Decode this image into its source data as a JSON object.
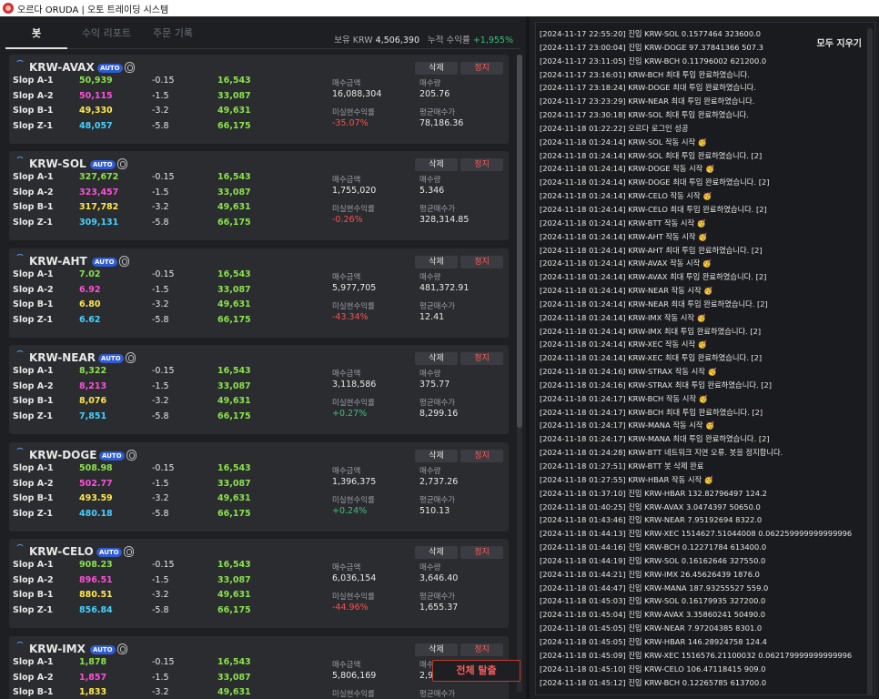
{
  "window": {
    "title": "오르다 ORUDA | 오토 트레이딩 시스템"
  },
  "tabs": [
    {
      "label": "봇"
    },
    {
      "label": "수익 리포트"
    },
    {
      "label": "주문 기록"
    }
  ],
  "summary": {
    "krw_label": "보유 KRW",
    "krw_value": "4,506,390",
    "return_label": "누적 수익률",
    "return_value": "+1,955%"
  },
  "card_labels": {
    "buy_amount": "매수금액",
    "buy_qty": "매수량",
    "unrealized": "미실현수익률",
    "avg_price": "평균매수가",
    "delete": "삭제",
    "stop": "정지",
    "auto": "AUTO"
  },
  "bots": [
    {
      "coin": "KRW-AVAX",
      "rows": [
        {
          "label": "Slop A-1",
          "price": "50,939",
          "pct": "-0.15",
          "target": "16,543"
        },
        {
          "label": "Slop A-2",
          "price": "50,115",
          "pct": "-1.5",
          "target": "33,087"
        },
        {
          "label": "Slop B-1",
          "price": "49,330",
          "pct": "-3.2",
          "target": "49,631"
        },
        {
          "label": "Slop Z-1",
          "price": "48,057",
          "pct": "-5.8",
          "target": "66,175"
        }
      ],
      "buy_amount": "16,088,304",
      "buy_qty": "205.76",
      "unrealized": "-35.07%",
      "avg_price": "78,186.36"
    },
    {
      "coin": "KRW-SOL",
      "rows": [
        {
          "label": "Slop A-1",
          "price": "327,672",
          "pct": "-0.15",
          "target": "16,543"
        },
        {
          "label": "Slop A-2",
          "price": "323,457",
          "pct": "-1.5",
          "target": "33,087"
        },
        {
          "label": "Slop B-1",
          "price": "317,782",
          "pct": "-3.2",
          "target": "49,631"
        },
        {
          "label": "Slop Z-1",
          "price": "309,131",
          "pct": "-5.8",
          "target": "66,175"
        }
      ],
      "buy_amount": "1,755,020",
      "buy_qty": "5.346",
      "unrealized": "-0.26%",
      "avg_price": "328,314.85"
    },
    {
      "coin": "KRW-AHT",
      "rows": [
        {
          "label": "Slop A-1",
          "price": "7.02",
          "pct": "-0.15",
          "target": "16,543"
        },
        {
          "label": "Slop A-2",
          "price": "6.92",
          "pct": "-1.5",
          "target": "33,087"
        },
        {
          "label": "Slop B-1",
          "price": "6.80",
          "pct": "-3.2",
          "target": "49,631"
        },
        {
          "label": "Slop Z-1",
          "price": "6.62",
          "pct": "-5.8",
          "target": "66,175"
        }
      ],
      "buy_amount": "5,977,705",
      "buy_qty": "481,372.91",
      "unrealized": "-43.34%",
      "avg_price": "12.41"
    },
    {
      "coin": "KRW-NEAR",
      "rows": [
        {
          "label": "Slop A-1",
          "price": "8,322",
          "pct": "-0.15",
          "target": "16,543"
        },
        {
          "label": "Slop A-2",
          "price": "8,213",
          "pct": "-1.5",
          "target": "33,087"
        },
        {
          "label": "Slop B-1",
          "price": "8,076",
          "pct": "-3.2",
          "target": "49,631"
        },
        {
          "label": "Slop Z-1",
          "price": "7,851",
          "pct": "-5.8",
          "target": "66,175"
        }
      ],
      "buy_amount": "3,118,586",
      "buy_qty": "375.77",
      "unrealized": "+0.27%",
      "avg_price": "8,299.16"
    },
    {
      "coin": "KRW-DOGE",
      "rows": [
        {
          "label": "Slop A-1",
          "price": "508.98",
          "pct": "-0.15",
          "target": "16,543"
        },
        {
          "label": "Slop A-2",
          "price": "502.77",
          "pct": "-1.5",
          "target": "33,087"
        },
        {
          "label": "Slop B-1",
          "price": "493.59",
          "pct": "-3.2",
          "target": "49,631"
        },
        {
          "label": "Slop Z-1",
          "price": "480.18",
          "pct": "-5.8",
          "target": "66,175"
        }
      ],
      "buy_amount": "1,396,375",
      "buy_qty": "2,737.26",
      "unrealized": "+0.24%",
      "avg_price": "510.13"
    },
    {
      "coin": "KRW-CELO",
      "rows": [
        {
          "label": "Slop A-1",
          "price": "908.23",
          "pct": "-0.15",
          "target": "16,543"
        },
        {
          "label": "Slop A-2",
          "price": "896.51",
          "pct": "-1.5",
          "target": "33,087"
        },
        {
          "label": "Slop B-1",
          "price": "880.51",
          "pct": "-3.2",
          "target": "49,631"
        },
        {
          "label": "Slop Z-1",
          "price": "856.84",
          "pct": "-5.8",
          "target": "66,175"
        }
      ],
      "buy_amount": "6,036,154",
      "buy_qty": "3,646.40",
      "unrealized": "-44.96%",
      "avg_price": "1,655.37"
    },
    {
      "coin": "KRW-IMX",
      "rows": [
        {
          "label": "Slop A-1",
          "price": "1,878",
          "pct": "-0.15",
          "target": "16,543"
        },
        {
          "label": "Slop A-2",
          "price": "1,857",
          "pct": "-1.5",
          "target": "33,087"
        },
        {
          "label": "Slop B-1",
          "price": "1,833",
          "pct": "-3.2",
          "target": "49,631"
        },
        {
          "label": "Slop Z-1",
          "price": "",
          "pct": "",
          "target": ""
        }
      ],
      "buy_amount": "5,806,169",
      "buy_qty": "2,9",
      "unrealized": "",
      "avg_price": ""
    }
  ],
  "exit_button": "전체 탈출",
  "log": {
    "clear_label": "모두 지우기",
    "lines": [
      "[2024-11-17 22:55:20] 진입 KRW-SOL 0.1577464 323600.0",
      "[2024-11-17 23:00:04] 진입 KRW-DOGE 97.37841366 507.3",
      "[2024-11-17 23:11:05] 진입 KRW-BCH 0.11796002 621200.0",
      "[2024-11-17 23:16:01] KRW-BCH 최대 투입 완료하였습니다.",
      "[2024-11-17 23:18:24] KRW-DOGE 최대 투입 완료하였습니다.",
      "[2024-11-17 23:23:29] KRW-NEAR 최대 투입 완료하였습니다.",
      "[2024-11-17 23:30:18] KRW-SOL 최대 투입 완료하였습니다.",
      "[2024-11-18 01:22:22] 오르다 로그인 성공",
      "[2024-11-18 01:24:14] KRW-SOL 작동 시작 🥳",
      "[2024-11-18 01:24:14] KRW-SOL 최대 투입 완료하였습니다. [2]",
      "[2024-11-18 01:24:14] KRW-DOGE 작동 시작 🥳",
      "[2024-11-18 01:24:14] KRW-DOGE 최대 투입 완료하였습니다. [2]",
      "[2024-11-18 01:24:14] KRW-CELO 작동 시작 🥳",
      "[2024-11-18 01:24:14] KRW-CELO 최대 투입 완료하였습니다. [2]",
      "[2024-11-18 01:24:14] KRW-BTT 작동 시작 🥳",
      "[2024-11-18 01:24:14] KRW-AHT 작동 시작 🥳",
      "[2024-11-18 01:24:14] KRW-AHT 최대 투입 완료하였습니다. [2]",
      "[2024-11-18 01:24:14] KRW-AVAX 작동 시작 🥳",
      "[2024-11-18 01:24:14] KRW-AVAX 최대 투입 완료하였습니다. [2]",
      "[2024-11-18 01:24:14] KRW-NEAR 작동 시작 🥳",
      "[2024-11-18 01:24:14] KRW-NEAR 최대 투입 완료하였습니다. [2]",
      "[2024-11-18 01:24:14] KRW-IMX 작동 시작 🥳",
      "[2024-11-18 01:24:14] KRW-IMX 최대 투입 완료하였습니다. [2]",
      "[2024-11-18 01:24:14] KRW-XEC 작동 시작 🥳",
      "[2024-11-18 01:24:14] KRW-XEC 최대 투입 완료하였습니다. [2]",
      "[2024-11-18 01:24:16] KRW-STRAX 작동 시작 🥳",
      "[2024-11-18 01:24:16] KRW-STRAX 최대 투입 완료하였습니다. [2]",
      "[2024-11-18 01:24:17] KRW-BCH 작동 시작 🥳",
      "[2024-11-18 01:24:17] KRW-BCH 최대 투입 완료하였습니다. [2]",
      "[2024-11-18 01:24:17] KRW-MANA 작동 시작 🥳",
      "[2024-11-18 01:24:17] KRW-MANA 최대 투입 완료하였습니다. [2]",
      "[2024-11-18 01:24:28] KRW-BTT 네트워크 지연 오류. 봇을 정지합니다.",
      "[2024-11-18 01:27:51] KRW-BTT 봇 삭제 완료",
      "[2024-11-18 01:27:55] KRW-HBAR 작동 시작 🥳",
      "[2024-11-18 01:37:10] 진입 KRW-HBAR 132.82796497 124.2",
      "[2024-11-18 01:40:25] 진입 KRW-AVAX 3.0474397 50650.0",
      "[2024-11-18 01:43:46] 진입 KRW-NEAR 7.95192694 8322.0",
      "[2024-11-18 01:44:13] 진입 KRW-XEC 1514627.51044008 0.062259999999999996",
      "[2024-11-18 01:44:16] 진입 KRW-BCH 0.12271784 613400.0",
      "[2024-11-18 01:44:19] 진입 KRW-SOL 0.16162646 327550.0",
      "[2024-11-18 01:44:21] 진입 KRW-IMX 26.45626439 1876.0",
      "[2024-11-18 01:44:47] 진입 KRW-MANA 187.93255527 559.0",
      "[2024-11-18 01:45:03] 진입 KRW-SOL 0.16179935 327200.0",
      "[2024-11-18 01:45:04] 진입 KRW-AVAX 3.35860241 50490.0",
      "[2024-11-18 01:45:05] 진입 KRW-NEAR 7.97204385 8301.0",
      "[2024-11-18 01:45:05] 진입 KRW-HBAR 146.28924758 124.4",
      "[2024-11-18 01:45:09] 진입 KRW-XEC 1516576.21100032 0.062179999999999996",
      "[2024-11-18 01:45:10] 진입 KRW-CELO 106.47118415 909.0",
      "[2024-11-18 01:45:12] 진입 KRW-BCH 0.12265785 613700.0"
    ]
  },
  "colors": {
    "price_a1": "#8be34a",
    "price_a2": "#ff4fd8",
    "price_b1": "#ffe94a",
    "price_z1": "#45d1ff",
    "target": "#8be34a",
    "negative": "#ff4d4d",
    "positive": "#3ec07b",
    "accent": "#2f5bd3"
  }
}
